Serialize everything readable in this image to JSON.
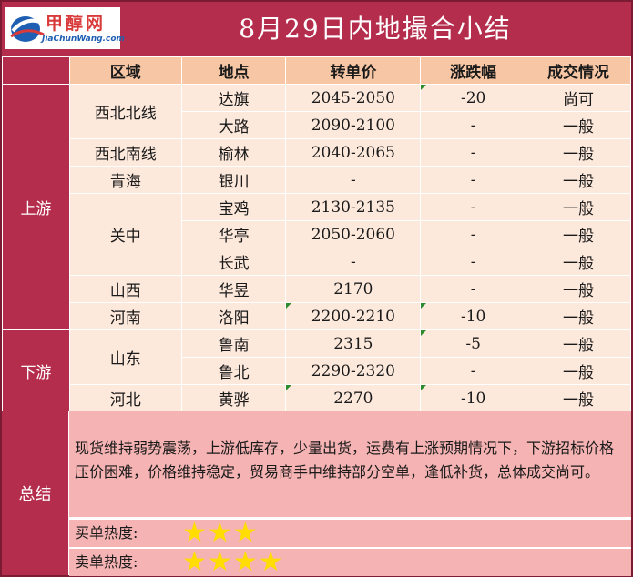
{
  "header": {
    "logo_cn": "甲醇网",
    "logo_en": "JiaChunWang.com",
    "title": "8月29日内地撮合小结"
  },
  "columns": [
    "区域",
    "地点",
    "转单价",
    "涨跌幅",
    "成交情况"
  ],
  "sections": {
    "upstream": "上游",
    "downstream": "下游",
    "summary": "总结"
  },
  "zones": {
    "xibei_bei": "西北北线",
    "xibei_nan": "西北南线",
    "qinghai": "青海",
    "guanzhong": "关中",
    "shanxi": "山西",
    "henan": "河南",
    "shandong": "山东",
    "hebei": "河北"
  },
  "rows": [
    {
      "place": "达旗",
      "price": "2045-2050",
      "change": "-20",
      "deal": "尚可"
    },
    {
      "place": "大路",
      "price": "2090-2100",
      "change": "-",
      "deal": "一般"
    },
    {
      "place": "榆林",
      "price": "2040-2065",
      "change": "-",
      "deal": "一般"
    },
    {
      "place": "银川",
      "price": "-",
      "change": "-",
      "deal": "一般"
    },
    {
      "place": "宝鸡",
      "price": "2130-2135",
      "change": "-",
      "deal": "一般"
    },
    {
      "place": "华亭",
      "price": "2050-2060",
      "change": "-",
      "deal": "一般"
    },
    {
      "place": "长武",
      "price": "-",
      "change": "-",
      "deal": "一般"
    },
    {
      "place": "华昱",
      "price": "2170",
      "change": "-",
      "deal": "一般"
    },
    {
      "place": "洛阳",
      "price": "2200-2210",
      "change": "-10",
      "deal": "一般"
    },
    {
      "place": "鲁南",
      "price": "2315",
      "change": "-5",
      "deal": "一般"
    },
    {
      "place": "鲁北",
      "price": "2290-2320",
      "change": "-",
      "deal": "一般"
    },
    {
      "place": "黄骅",
      "price": "2270",
      "change": "-10",
      "deal": "一般"
    }
  ],
  "summary": {
    "text": "现货维持弱势震荡，上游低库存，少量出货，运费有上涨预期情况下，下游招标价格压价困难，价格维持稳定，贸易商手中维持部分空单，逢低补货，总体成交尚可。",
    "buy_label": "买单热度:",
    "buy_stars": 3,
    "sell_label": "卖单热度:",
    "sell_stars": 4,
    "star_color": "#ffdd00"
  },
  "colors": {
    "brand": "#b52d4c",
    "header_cell": "#f7c6a5",
    "body_cell": "#fde9dc",
    "summary_bg": "#f5b3b3"
  }
}
